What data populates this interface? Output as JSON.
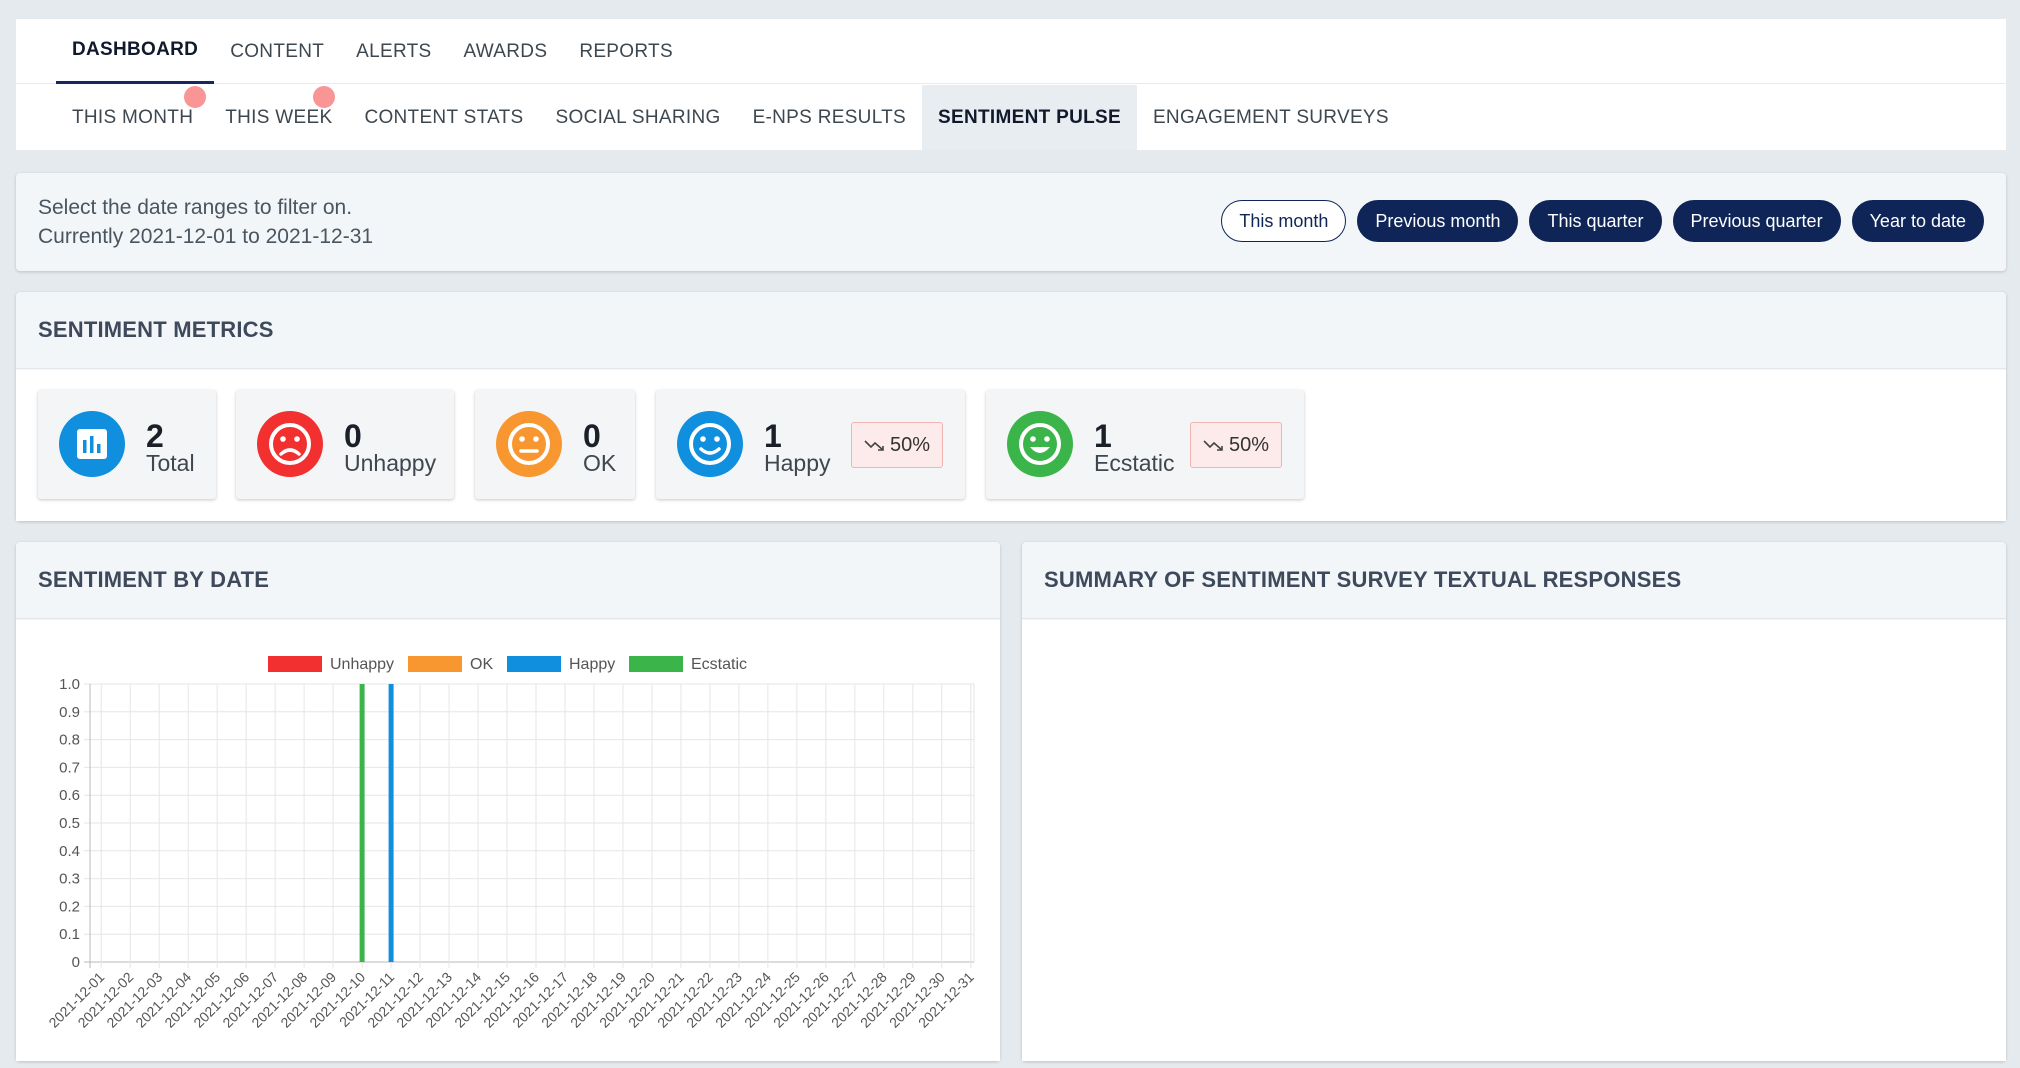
{
  "nav": {
    "tabs": [
      "DASHBOARD",
      "CONTENT",
      "ALERTS",
      "AWARDS",
      "REPORTS"
    ],
    "subtabs": [
      "THIS MONTH",
      "THIS WEEK",
      "CONTENT STATS",
      "SOCIAL SHARING",
      "E-NPS RESULTS",
      "SENTIMENT PULSE",
      "ENGAGEMENT SURVEYS"
    ]
  },
  "filter": {
    "line1": "Select the date ranges to filter on.",
    "line2": "Currently 2021-12-01 to 2021-12-31",
    "buttons": [
      "This month",
      "Previous month",
      "This quarter",
      "Previous quarter",
      "Year to date"
    ]
  },
  "metrics": {
    "title": "SENTIMENT METRICS",
    "items": [
      {
        "value": "2",
        "label": "Total",
        "icon": "bar-chart-icon",
        "color": "#0f8fdd"
      },
      {
        "value": "0",
        "label": "Unhappy",
        "icon": "sad-face-icon",
        "color": "#f2302f"
      },
      {
        "value": "0",
        "label": "OK",
        "icon": "neutral-face-icon",
        "color": "#f8962f"
      },
      {
        "value": "1",
        "label": "Happy",
        "icon": "smile-face-icon",
        "color": "#0f8fdd",
        "badge": "50%",
        "trend_icon": "trend-down-icon"
      },
      {
        "value": "1",
        "label": "Ecstatic",
        "icon": "grin-face-icon",
        "color": "#3bb54a",
        "badge": "50%",
        "trend_icon": "trend-down-icon"
      }
    ]
  },
  "sentiment_by_date": {
    "title": "SENTIMENT BY DATE"
  },
  "summary": {
    "title": "SUMMARY OF SENTIMENT SURVEY TEXTUAL RESPONSES"
  },
  "chart_data": {
    "type": "bar",
    "categories": [
      "2021-12-01",
      "2021-12-02",
      "2021-12-03",
      "2021-12-04",
      "2021-12-05",
      "2021-12-06",
      "2021-12-07",
      "2021-12-08",
      "2021-12-09",
      "2021-12-10",
      "2021-12-11",
      "2021-12-12",
      "2021-12-13",
      "2021-12-14",
      "2021-12-15",
      "2021-12-16",
      "2021-12-17",
      "2021-12-18",
      "2021-12-19",
      "2021-12-20",
      "2021-12-21",
      "2021-12-22",
      "2021-12-23",
      "2021-12-24",
      "2021-12-25",
      "2021-12-26",
      "2021-12-27",
      "2021-12-28",
      "2021-12-29",
      "2021-12-30",
      "2021-12-31"
    ],
    "series": [
      {
        "name": "Unhappy",
        "color": "#f2302f",
        "values": [
          0,
          0,
          0,
          0,
          0,
          0,
          0,
          0,
          0,
          0,
          0,
          0,
          0,
          0,
          0,
          0,
          0,
          0,
          0,
          0,
          0,
          0,
          0,
          0,
          0,
          0,
          0,
          0,
          0,
          0,
          0
        ]
      },
      {
        "name": "OK",
        "color": "#f8962f",
        "values": [
          0,
          0,
          0,
          0,
          0,
          0,
          0,
          0,
          0,
          0,
          0,
          0,
          0,
          0,
          0,
          0,
          0,
          0,
          0,
          0,
          0,
          0,
          0,
          0,
          0,
          0,
          0,
          0,
          0,
          0,
          0
        ]
      },
      {
        "name": "Happy",
        "color": "#0f8fdd",
        "values": [
          0,
          0,
          0,
          0,
          0,
          0,
          0,
          0,
          0,
          0,
          1,
          0,
          0,
          0,
          0,
          0,
          0,
          0,
          0,
          0,
          0,
          0,
          0,
          0,
          0,
          0,
          0,
          0,
          0,
          0,
          0
        ]
      },
      {
        "name": "Ecstatic",
        "color": "#3bb54a",
        "values": [
          0,
          0,
          0,
          0,
          0,
          0,
          0,
          0,
          0,
          1,
          0,
          0,
          0,
          0,
          0,
          0,
          0,
          0,
          0,
          0,
          0,
          0,
          0,
          0,
          0,
          0,
          0,
          0,
          0,
          0,
          0
        ]
      }
    ],
    "yticks": [
      "1.0",
      "0.9",
      "0.8",
      "0.7",
      "0.6",
      "0.5",
      "0.4",
      "0.3",
      "0.2",
      "0.1",
      "0"
    ],
    "ylim": [
      0,
      1
    ],
    "grid": true,
    "legend": "top"
  }
}
